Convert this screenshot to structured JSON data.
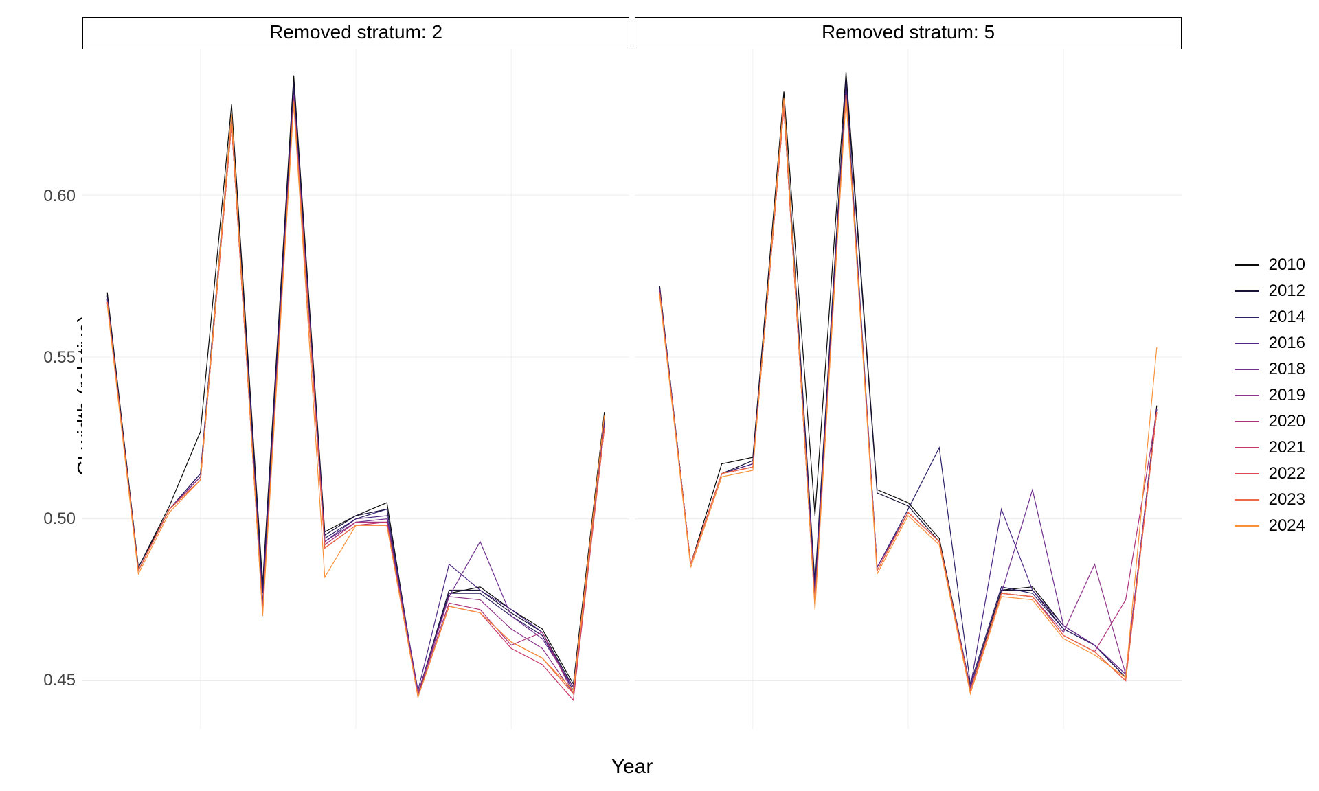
{
  "chart_data": [
    {
      "type": "line",
      "strip_title": "Removed stratum: 2",
      "xlabel": "Year",
      "ylabel": "CI width (relative)",
      "x_breaks": [
        2010,
        2015,
        2020
      ],
      "y_breaks": [
        0.45,
        0.5,
        0.55,
        0.6
      ],
      "xlim": [
        2006.2,
        2023.8
      ],
      "ylim": [
        0.435,
        0.645
      ],
      "legend_title": "",
      "series": [
        {
          "name": "2010",
          "x": [
            2007,
            2008,
            2009,
            2010,
            2011,
            2012,
            2013,
            2014,
            2015,
            2016,
            2017,
            2018,
            2019,
            2020,
            2021,
            2022,
            2023
          ],
          "y": [
            0.57,
            0.485,
            0.504,
            0.527,
            0.628,
            0.48,
            0.637,
            0.496,
            0.501,
            0.505,
            0.445,
            0.477,
            0.479,
            0.472,
            0.466,
            0.449,
            0.533
          ]
        },
        {
          "name": "2012",
          "x": [
            2007,
            2008,
            2009,
            2010,
            2011,
            2012,
            2013,
            2014,
            2015,
            2016,
            2017,
            2018,
            2019,
            2020,
            2021,
            2022,
            2023
          ],
          "y": [
            0.569,
            0.485,
            0.503,
            0.514,
            0.625,
            0.479,
            0.635,
            0.495,
            0.501,
            0.503,
            0.446,
            0.478,
            0.478,
            0.471,
            0.465,
            0.448,
            0.531
          ]
        },
        {
          "name": "2014",
          "x": [
            2007,
            2008,
            2009,
            2010,
            2011,
            2012,
            2013,
            2014,
            2015,
            2016,
            2017,
            2018,
            2019,
            2020,
            2021,
            2022,
            2023
          ],
          "y": [
            0.568,
            0.484,
            0.503,
            0.514,
            0.624,
            0.477,
            0.633,
            0.494,
            0.5,
            0.503,
            0.446,
            0.477,
            0.477,
            0.47,
            0.464,
            0.447,
            0.53
          ]
        },
        {
          "name": "2016",
          "x": [
            2007,
            2008,
            2009,
            2010,
            2011,
            2012,
            2013,
            2014,
            2015,
            2016,
            2017,
            2018,
            2019,
            2020,
            2021,
            2022,
            2023
          ],
          "y": [
            0.568,
            0.484,
            0.503,
            0.513,
            0.623,
            0.474,
            0.631,
            0.493,
            0.5,
            0.501,
            0.447,
            0.486,
            0.478,
            0.472,
            0.465,
            0.447,
            0.531
          ]
        },
        {
          "name": "2018",
          "x": [
            2007,
            2008,
            2009,
            2010,
            2011,
            2012,
            2013,
            2014,
            2015,
            2016,
            2017,
            2018,
            2019,
            2020,
            2021,
            2022,
            2023
          ],
          "y": [
            0.567,
            0.484,
            0.503,
            0.513,
            0.622,
            0.473,
            0.631,
            0.493,
            0.499,
            0.5,
            0.446,
            0.476,
            0.493,
            0.47,
            0.463,
            0.448,
            0.529
          ]
        },
        {
          "name": "2019",
          "x": [
            2007,
            2008,
            2009,
            2010,
            2011,
            2012,
            2013,
            2014,
            2015,
            2016,
            2017,
            2018,
            2019,
            2020,
            2021,
            2022,
            2023
          ],
          "y": [
            0.567,
            0.484,
            0.503,
            0.513,
            0.622,
            0.472,
            0.63,
            0.492,
            0.499,
            0.499,
            0.446,
            0.476,
            0.475,
            0.466,
            0.46,
            0.446,
            0.528
          ]
        },
        {
          "name": "2020",
          "x": [
            2007,
            2008,
            2009,
            2010,
            2011,
            2012,
            2013,
            2014,
            2015,
            2016,
            2017,
            2018,
            2019,
            2020,
            2021,
            2022,
            2023
          ],
          "y": [
            0.567,
            0.484,
            0.503,
            0.512,
            0.622,
            0.472,
            0.629,
            0.492,
            0.499,
            0.499,
            0.446,
            0.474,
            0.472,
            0.461,
            0.465,
            0.446,
            0.528
          ]
        },
        {
          "name": "2021",
          "x": [
            2007,
            2008,
            2009,
            2010,
            2011,
            2012,
            2013,
            2014,
            2015,
            2016,
            2017,
            2018,
            2019,
            2020,
            2021,
            2022,
            2023
          ],
          "y": [
            0.567,
            0.484,
            0.503,
            0.512,
            0.622,
            0.471,
            0.629,
            0.491,
            0.498,
            0.499,
            0.445,
            0.473,
            0.471,
            0.46,
            0.455,
            0.444,
            0.528
          ]
        },
        {
          "name": "2022",
          "x": [
            2007,
            2008,
            2009,
            2010,
            2011,
            2012,
            2013,
            2014,
            2015,
            2016,
            2017,
            2018,
            2019,
            2020,
            2021,
            2022,
            2023
          ],
          "y": [
            0.567,
            0.484,
            0.503,
            0.512,
            0.622,
            0.471,
            0.629,
            0.491,
            0.498,
            0.498,
            0.445,
            0.473,
            0.471,
            0.462,
            0.457,
            0.446,
            0.528
          ]
        },
        {
          "name": "2023",
          "x": [
            2007,
            2008,
            2009,
            2010,
            2011,
            2012,
            2013,
            2014,
            2015,
            2016,
            2017,
            2018,
            2019,
            2020,
            2021,
            2022,
            2023
          ],
          "y": [
            0.567,
            0.484,
            0.503,
            0.512,
            0.622,
            0.471,
            0.629,
            0.491,
            0.498,
            0.498,
            0.445,
            0.473,
            0.471,
            0.462,
            0.457,
            0.446,
            0.528
          ]
        },
        {
          "name": "2024",
          "x": [
            2007,
            2008,
            2009,
            2010,
            2011,
            2012,
            2013,
            2014,
            2015,
            2016,
            2017,
            2018,
            2019,
            2020,
            2021,
            2022,
            2023
          ],
          "y": [
            0.566,
            0.483,
            0.502,
            0.512,
            0.625,
            0.47,
            0.628,
            0.482,
            0.498,
            0.498,
            0.445,
            0.473,
            0.471,
            0.462,
            0.457,
            0.447,
            0.532
          ]
        }
      ]
    },
    {
      "type": "line",
      "strip_title": "Removed stratum: 5",
      "xlabel": "Year",
      "ylabel": "CI width (relative)",
      "x_breaks": [
        2010,
        2015,
        2020
      ],
      "y_breaks": [
        0.45,
        0.5,
        0.55,
        0.6
      ],
      "xlim": [
        2006.2,
        2023.8
      ],
      "ylim": [
        0.435,
        0.645
      ],
      "legend_title": "",
      "series": [
        {
          "name": "2010",
          "x": [
            2007,
            2008,
            2009,
            2010,
            2011,
            2012,
            2013,
            2014,
            2015,
            2016,
            2017,
            2018,
            2019,
            2020,
            2021,
            2022,
            2023
          ],
          "y": [
            0.572,
            0.486,
            0.517,
            0.519,
            0.632,
            0.501,
            0.638,
            0.509,
            0.505,
            0.494,
            0.448,
            0.478,
            0.479,
            0.467,
            0.461,
            0.451,
            0.535
          ]
        },
        {
          "name": "2012",
          "x": [
            2007,
            2008,
            2009,
            2010,
            2011,
            2012,
            2013,
            2014,
            2015,
            2016,
            2017,
            2018,
            2019,
            2020,
            2021,
            2022,
            2023
          ],
          "y": [
            0.572,
            0.486,
            0.514,
            0.518,
            0.63,
            0.48,
            0.636,
            0.508,
            0.504,
            0.493,
            0.448,
            0.478,
            0.478,
            0.466,
            0.461,
            0.451,
            0.534
          ]
        },
        {
          "name": "2014",
          "x": [
            2007,
            2008,
            2009,
            2010,
            2011,
            2012,
            2013,
            2014,
            2015,
            2016,
            2017,
            2018,
            2019,
            2020,
            2021,
            2022,
            2023
          ],
          "y": [
            0.571,
            0.486,
            0.514,
            0.517,
            0.629,
            0.478,
            0.635,
            0.485,
            0.503,
            0.522,
            0.449,
            0.479,
            0.477,
            0.466,
            0.461,
            0.451,
            0.533
          ]
        },
        {
          "name": "2016",
          "x": [
            2007,
            2008,
            2009,
            2010,
            2011,
            2012,
            2013,
            2014,
            2015,
            2016,
            2017,
            2018,
            2019,
            2020,
            2021,
            2022,
            2023
          ],
          "y": [
            0.571,
            0.486,
            0.514,
            0.517,
            0.628,
            0.476,
            0.633,
            0.485,
            0.502,
            0.493,
            0.448,
            0.503,
            0.478,
            0.467,
            0.461,
            0.452,
            0.534
          ]
        },
        {
          "name": "2018",
          "x": [
            2007,
            2008,
            2009,
            2010,
            2011,
            2012,
            2013,
            2014,
            2015,
            2016,
            2017,
            2018,
            2019,
            2020,
            2021,
            2022,
            2023
          ],
          "y": [
            0.571,
            0.486,
            0.514,
            0.516,
            0.628,
            0.475,
            0.632,
            0.485,
            0.502,
            0.493,
            0.448,
            0.477,
            0.509,
            0.467,
            0.461,
            0.452,
            0.534
          ]
        },
        {
          "name": "2019",
          "x": [
            2007,
            2008,
            2009,
            2010,
            2011,
            2012,
            2013,
            2014,
            2015,
            2016,
            2017,
            2018,
            2019,
            2020,
            2021,
            2022,
            2023
          ],
          "y": [
            0.57,
            0.486,
            0.514,
            0.516,
            0.627,
            0.474,
            0.631,
            0.484,
            0.502,
            0.493,
            0.447,
            0.477,
            0.476,
            0.465,
            0.486,
            0.452,
            0.533
          ]
        },
        {
          "name": "2020",
          "x": [
            2007,
            2008,
            2009,
            2010,
            2011,
            2012,
            2013,
            2014,
            2015,
            2016,
            2017,
            2018,
            2019,
            2020,
            2021,
            2022,
            2023
          ],
          "y": [
            0.57,
            0.486,
            0.514,
            0.516,
            0.627,
            0.473,
            0.631,
            0.484,
            0.502,
            0.493,
            0.447,
            0.477,
            0.476,
            0.464,
            0.459,
            0.475,
            0.533
          ]
        },
        {
          "name": "2021",
          "x": [
            2007,
            2008,
            2009,
            2010,
            2011,
            2012,
            2013,
            2014,
            2015,
            2016,
            2017,
            2018,
            2019,
            2020,
            2021,
            2022,
            2023
          ],
          "y": [
            0.57,
            0.486,
            0.514,
            0.516,
            0.627,
            0.473,
            0.631,
            0.484,
            0.502,
            0.493,
            0.447,
            0.477,
            0.476,
            0.464,
            0.459,
            0.45,
            0.533
          ]
        },
        {
          "name": "2022",
          "x": [
            2007,
            2008,
            2009,
            2010,
            2011,
            2012,
            2013,
            2014,
            2015,
            2016,
            2017,
            2018,
            2019,
            2020,
            2021,
            2022,
            2023
          ],
          "y": [
            0.57,
            0.486,
            0.514,
            0.516,
            0.627,
            0.473,
            0.631,
            0.484,
            0.502,
            0.493,
            0.447,
            0.477,
            0.476,
            0.464,
            0.459,
            0.45,
            0.533
          ]
        },
        {
          "name": "2023",
          "x": [
            2007,
            2008,
            2009,
            2010,
            2011,
            2012,
            2013,
            2014,
            2015,
            2016,
            2017,
            2018,
            2019,
            2020,
            2021,
            2022,
            2023
          ],
          "y": [
            0.57,
            0.486,
            0.514,
            0.516,
            0.627,
            0.473,
            0.631,
            0.484,
            0.502,
            0.493,
            0.447,
            0.477,
            0.476,
            0.464,
            0.459,
            0.45,
            0.533
          ]
        },
        {
          "name": "2024",
          "x": [
            2007,
            2008,
            2009,
            2010,
            2011,
            2012,
            2013,
            2014,
            2015,
            2016,
            2017,
            2018,
            2019,
            2020,
            2021,
            2022,
            2023
          ],
          "y": [
            0.569,
            0.485,
            0.513,
            0.515,
            0.63,
            0.472,
            0.63,
            0.483,
            0.501,
            0.492,
            0.446,
            0.476,
            0.475,
            0.463,
            0.458,
            0.451,
            0.553
          ]
        }
      ]
    }
  ],
  "xlabel": "Year",
  "ylabel": "CI width (relative)",
  "legend_names": [
    "2010",
    "2012",
    "2014",
    "2016",
    "2018",
    "2019",
    "2020",
    "2021",
    "2022",
    "2023",
    "2024"
  ],
  "colors": {
    "2010": "#0B0B0B",
    "2012": "#1A1438",
    "2014": "#2C1E63",
    "2016": "#4C2884",
    "2018": "#6E2F8E",
    "2019": "#8C3489",
    "2020": "#AB337C",
    "2021": "#C73869",
    "2022": "#DE4A57",
    "2023": "#ED6A47",
    "2024": "#F8923A"
  },
  "y_tick_labels": [
    "0.45",
    "0.50",
    "0.55",
    "0.60"
  ]
}
